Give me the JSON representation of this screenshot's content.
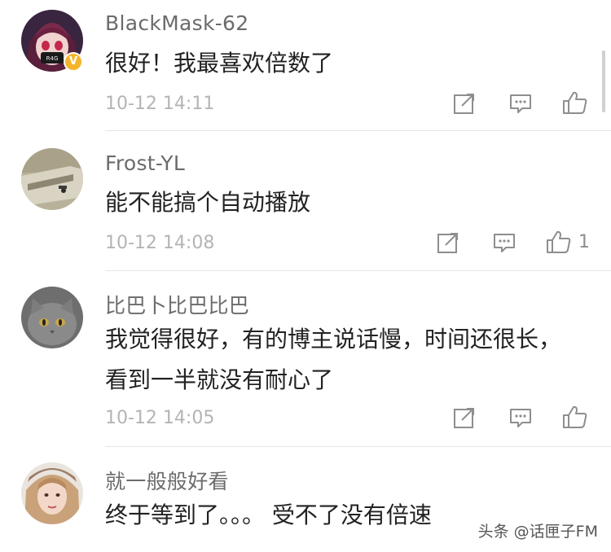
{
  "comments": [
    {
      "username": "BlackMask-62",
      "text": "很好！我最喜欢倍数了",
      "time": "10-12 14:11",
      "likes": "",
      "verified": true,
      "avatar": "anime-avatar"
    },
    {
      "username": "Frost-YL",
      "text": "能不能搞个自动播放",
      "time": "10-12 14:08",
      "likes": "1",
      "verified": false,
      "avatar": "device-photo-avatar"
    },
    {
      "username": "比巴卜比巴比巴",
      "text": "我觉得很好，有的博主说话慢，时间还很长，看到一半就没有耐心了",
      "time": "10-12 14:05",
      "likes": "",
      "verified": false,
      "avatar": "cat-avatar"
    },
    {
      "username": "就一般般好看",
      "text": "终于等到了。。。 受不了没有倍速",
      "time": "",
      "likes": "",
      "verified": false,
      "avatar": "girl-avatar"
    }
  ],
  "actions": {
    "share_icon": "share-icon",
    "reply_icon": "reply-icon",
    "like_icon": "like-icon"
  },
  "watermark": "头条 @话匣子FM",
  "colors": {
    "username": "#6b6b6b",
    "text": "#222222",
    "meta": "#b4b4b4",
    "icon": "#8e8e8e",
    "badge": "#f4b52c"
  }
}
